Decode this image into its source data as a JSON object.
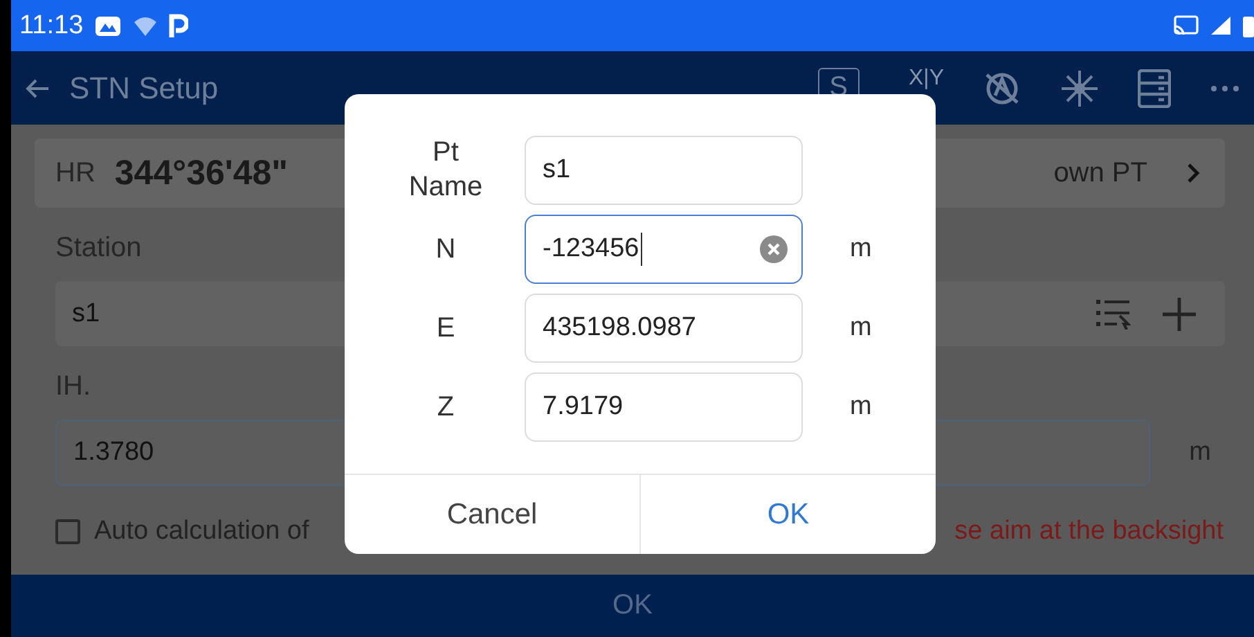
{
  "status_bar": {
    "time": "11:13"
  },
  "app_bar": {
    "title": "STN Setup",
    "mode_button": "S",
    "axis_toggle": "X|Y"
  },
  "hr": {
    "label": "HR",
    "value": "344°36'48\""
  },
  "known_point": {
    "label": "own PT"
  },
  "station": {
    "label": "Station",
    "value": "s1"
  },
  "ih": {
    "label": "IH.",
    "value": "1.3780",
    "unit": "m"
  },
  "auto_calc": {
    "label": "Auto calculation of",
    "checked": false
  },
  "warning": "se aim at the backsight",
  "footer_button": "OK",
  "dialog": {
    "fields": [
      {
        "label": "Pt Name",
        "value": "s1",
        "focused": false
      },
      {
        "label": "N",
        "value": "-123456",
        "unit": "m",
        "focused": true
      },
      {
        "label": "E",
        "value": "435198.0987",
        "unit": "m",
        "focused": false
      },
      {
        "label": "Z",
        "value": "7.9179",
        "unit": "m",
        "focused": false
      }
    ],
    "buttons": [
      {
        "kind": "cancel",
        "label": "Cancel"
      },
      {
        "kind": "confirm",
        "label": "OK"
      }
    ]
  }
}
